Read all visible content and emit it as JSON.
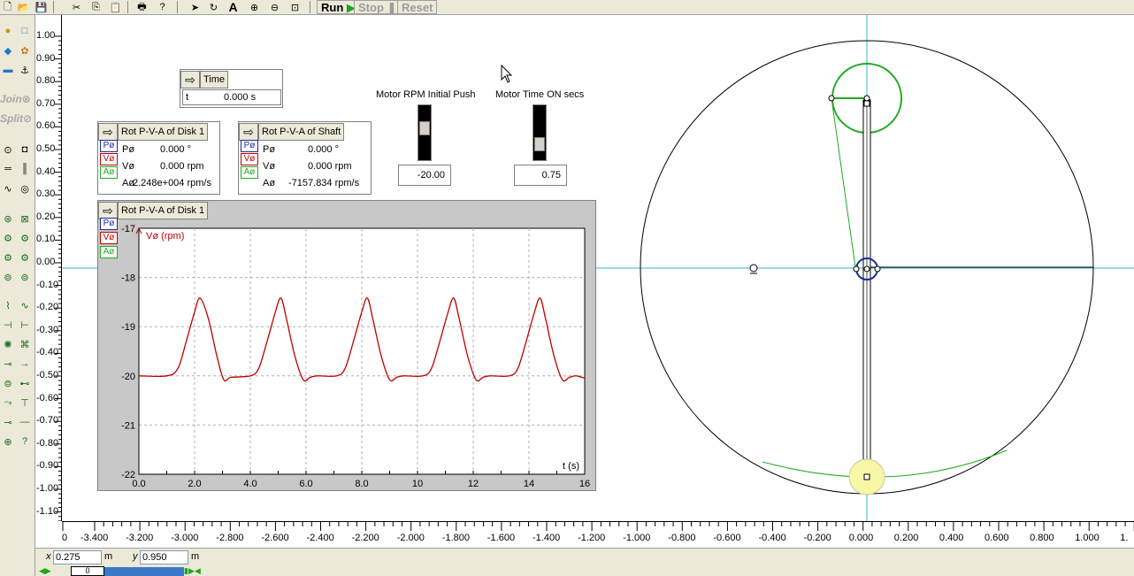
{
  "toolbar": {
    "run_label": "Run",
    "stop_label": "Stop",
    "reset_label": "Reset"
  },
  "palette": {
    "join_label": "Join",
    "split_label": "Split"
  },
  "vruler": {
    "labels": [
      "1.00",
      "0.90",
      "0.80",
      "0.70",
      "0.60",
      "0.50",
      "0.40",
      "0.30",
      "0.20",
      "0.10",
      "0.00",
      "-0.10",
      "-0.20",
      "-0.30",
      "-0.40",
      "-0.50",
      "-0.60",
      "-0.70",
      "-0.80",
      "-0.90",
      "-1.00",
      "-1.10"
    ]
  },
  "hruler": {
    "labels": [
      "0",
      "-3.400",
      "-3.200",
      "-3.000",
      "-2.800",
      "-2.600",
      "-2.400",
      "-2.200",
      "-2.000",
      "-1.800",
      "-1.600",
      "-1.400",
      "-1.200",
      "-1.000",
      "-0.800",
      "-0.600",
      "-0.400",
      "-0.200",
      "0.000",
      "0.200",
      "0.400",
      "0.600",
      "0.800",
      "1.000",
      "1."
    ]
  },
  "coords": {
    "x_label": "x",
    "x_value": "0.275",
    "x_unit": "m",
    "y_label": "y",
    "y_value": "0.950",
    "y_unit": "m"
  },
  "timebar": {
    "value": "0"
  },
  "time_meter": {
    "title": "Time",
    "label": "t",
    "value": "0.000 s"
  },
  "disk_meter": {
    "title": "Rot P-V-A of Disk 1",
    "btn_p": "Pø",
    "btn_v": "Vø",
    "btn_a": "Aø",
    "p_label": "Pø",
    "p_value": "0.000 °",
    "v_label": "Vø",
    "v_value": "0.000 rpm",
    "a_label": "Aø",
    "a_value": "2.248e+004 rpm/s"
  },
  "shaft_meter": {
    "title": "Rot P-V-A of Shaft",
    "btn_p": "Pø",
    "btn_v": "Vø",
    "btn_a": "Aø",
    "p_label": "Pø",
    "p_value": "0.000 °",
    "v_label": "Vø",
    "v_value": "0.000 rpm",
    "a_label": "Aø",
    "a_value": "-7157.834 rpm/s"
  },
  "slider_rpm": {
    "label": "Motor RPM Initial Push",
    "value": "-20.00"
  },
  "slider_time": {
    "label": "Motor Time ON secs",
    "value": "0.75"
  },
  "graph": {
    "title": "Rot P-V-A of Disk 1",
    "btn_p": "Pø",
    "btn_v": "Vø",
    "btn_a": "Aø"
  },
  "colors": {
    "curve": "#c00000",
    "crank_circle": "#22aa22",
    "pivot": "#1a2aa8",
    "bob": "#f7f7a6",
    "crosshair": "#3ab0e0"
  },
  "chart_data": {
    "type": "line",
    "title": "",
    "xlabel": "t (s)",
    "ylabel": "Vø (rpm)",
    "xlim": [
      0,
      16
    ],
    "ylim": [
      -22,
      -17
    ],
    "x_ticks": [
      "0.0",
      "2.0",
      "4.0",
      "6.0",
      "8.0",
      "10",
      "12",
      "14",
      "16"
    ],
    "y_ticks": [
      "-17",
      "-18",
      "-19",
      "-20",
      "-21",
      "-22"
    ],
    "grid": true,
    "series": [
      {
        "name": "Vø (rpm)",
        "x": [
          0.0,
          1.0,
          1.4,
          1.7,
          2.0,
          2.2,
          2.5,
          2.8,
          3.05,
          3.3,
          4.0,
          4.3,
          4.6,
          4.9,
          5.1,
          5.3,
          5.6,
          5.9,
          6.15,
          6.4,
          7.1,
          7.4,
          7.7,
          8.0,
          8.2,
          8.4,
          8.7,
          9.0,
          9.25,
          9.5,
          10.2,
          10.5,
          10.8,
          11.1,
          11.3,
          11.5,
          11.8,
          12.1,
          12.35,
          12.6,
          13.3,
          13.6,
          13.9,
          14.2,
          14.4,
          14.6,
          14.9,
          15.2,
          15.45,
          15.7,
          16.0
        ],
        "y": [
          -20.0,
          -20.0,
          -19.85,
          -19.3,
          -18.7,
          -18.42,
          -18.85,
          -19.6,
          -20.08,
          -20.03,
          -20.0,
          -19.85,
          -19.3,
          -18.7,
          -18.42,
          -18.85,
          -19.6,
          -20.08,
          -20.03,
          -20.0,
          -20.0,
          -19.85,
          -19.3,
          -18.7,
          -18.42,
          -18.85,
          -19.6,
          -20.08,
          -20.03,
          -20.0,
          -20.0,
          -19.85,
          -19.3,
          -18.7,
          -18.42,
          -18.85,
          -19.6,
          -20.08,
          -20.03,
          -20.0,
          -20.0,
          -19.85,
          -19.3,
          -18.7,
          -18.42,
          -18.85,
          -19.6,
          -20.08,
          -20.03,
          -20.0,
          -20.05
        ]
      }
    ]
  }
}
